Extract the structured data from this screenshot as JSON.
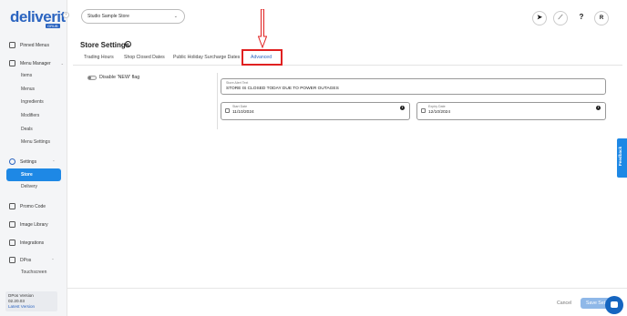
{
  "app": {
    "logo": "deliverit",
    "logo_sub": "GRUB"
  },
  "sidebar": {
    "items": [
      {
        "label": "Pinned Menus",
        "icon": "pin-icon"
      },
      {
        "label": "Menu Manager",
        "icon": "menu-icon"
      },
      {
        "label": "Items"
      },
      {
        "label": "Menus"
      },
      {
        "label": "Ingredients"
      },
      {
        "label": "Modifiers"
      },
      {
        "label": "Deals"
      },
      {
        "label": "Menu Settings"
      },
      {
        "label": "Settings",
        "icon": "gear-icon"
      },
      {
        "label": "Store"
      },
      {
        "label": "Delivery"
      },
      {
        "label": "Promo Code",
        "icon": "promo-icon"
      },
      {
        "label": "Image Library",
        "icon": "image-icon"
      },
      {
        "label": "Integrations",
        "icon": "integrations-icon"
      },
      {
        "label": "DPos",
        "icon": "dpos-icon"
      },
      {
        "label": "Touchscreen"
      }
    ],
    "active": "Store"
  },
  "version": {
    "title": "DPos Version",
    "number": "02.20.03",
    "link": "Latest Version"
  },
  "topbar": {
    "store": "Studio Sample Store",
    "buttons": [
      {
        "icon": "rocket-icon",
        "glyph": "➤"
      },
      {
        "icon": "launch-icon",
        "glyph": "⟋"
      },
      {
        "icon": "help-icon",
        "glyph": "?"
      },
      {
        "icon": "user-avatar",
        "glyph": "R"
      }
    ]
  },
  "page": {
    "title": "Store Settings",
    "tabs": [
      "Trading Hours",
      "Shop Closed Dates",
      "Public Holiday Surcharge Dates",
      "Advanced"
    ],
    "active_tab": "Advanced"
  },
  "advanced": {
    "toggle_label": "Disable 'NEW' flag",
    "store_alert_label": "Store Alert Text",
    "store_alert_value": "STORE IS CLOSED TODAY DUE TO POWER OUTAGES",
    "start_date_label": "Start Date",
    "start_date_value": "11/10/2024",
    "expiry_date_label": "Expiry Date",
    "expiry_date_value": "12/10/2024"
  },
  "footer": {
    "cancel": "Cancel",
    "save": "Save Set"
  },
  "feedback": {
    "label": "Feedback"
  },
  "colors": {
    "accent": "#2b64c0",
    "active_nav": "#1e88e5",
    "highlight": "#e02020"
  }
}
